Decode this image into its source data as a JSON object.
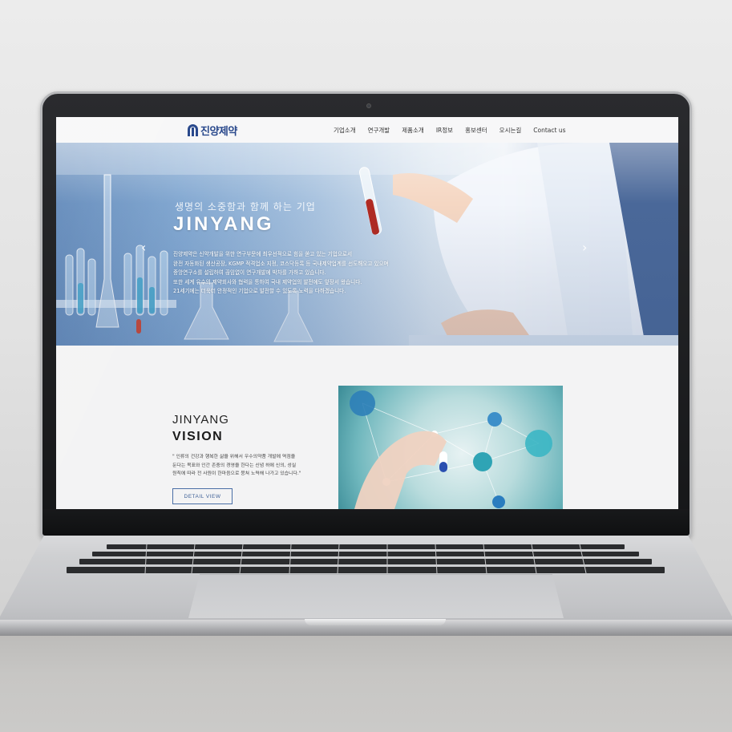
{
  "site": {
    "logo_text": "진양제약",
    "nav": [
      "기업소개",
      "연구개발",
      "제품소개",
      "IR정보",
      "홍보센터",
      "오시는길",
      "Contact us"
    ]
  },
  "hero": {
    "subtitle": "생명의 소중함과 함께 하는 기업",
    "title": "JINYANG",
    "body_lines": [
      "진양제약은 신약개발을 위한 연구부문에 최우선적으로 힘을 쏟고 있는 기업으로서",
      "완전 자동화된 생산공장, KGMP 적격업소 지정, 코스닥등록 등 국내제약업계를 선도해오고 있으며",
      "중앙연구소를 설립하여 끊임없이 연구개발에 박차를 가하고 있습니다.",
      "또한 세계 유수의 제약회사와 협력을 통하여 국내 제약업의 발전에도 앞장서 왔습니다.",
      "21세기에는 더욱더 안정적인 기업으로 발전할 수 있도록 노력을 다하겠습니다."
    ],
    "prev_arrow": "‹",
    "next_arrow": "›"
  },
  "vision": {
    "kicker": "JINYANG",
    "title": "VISION",
    "desc_lines": [
      "\" 인류의 건강과 행복한 삶을 위해서 우수의약품 개발에 역점을",
      "둔다는 목표와 인간 존중의 경영을 한다는 신념 하에 신의, 성실",
      "원칙에 따라 전 사원이 한마음으로 뭉쳐 노력해 나가고 있습니다.\""
    ],
    "button_label": "DETAIL VIEW"
  },
  "colors": {
    "brand": "#1e3f86",
    "button_border": "#4a6ea6"
  }
}
